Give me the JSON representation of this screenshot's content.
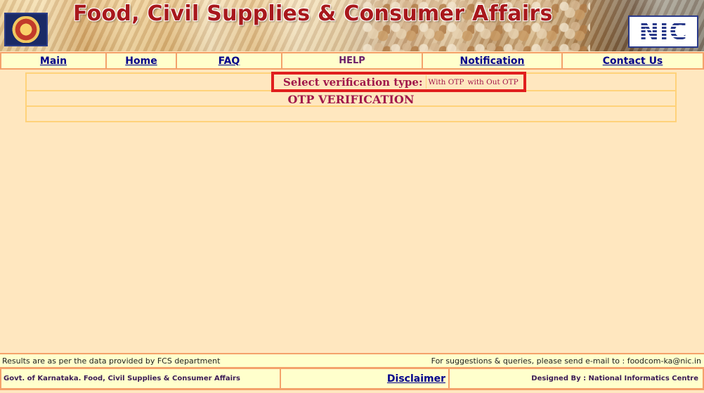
{
  "header": {
    "title": "Food, Civil Supplies & Consumer Affairs",
    "nic_logo_text": "NIC",
    "emblem_icon": "karnataka-emblem-icon"
  },
  "nav": {
    "items": [
      {
        "label": "Main",
        "link": true
      },
      {
        "label": "Home",
        "link": true
      },
      {
        "label": "FAQ",
        "link": true
      },
      {
        "label": "HELP",
        "link": false
      },
      {
        "label": "Notification",
        "link": true
      },
      {
        "label": "Contact Us",
        "link": true
      }
    ]
  },
  "verification": {
    "label": "Select verification type:",
    "options": [
      "With OTP",
      "with Out OTP"
    ]
  },
  "main": {
    "section_title": "OTP VERIFICATION"
  },
  "footer": {
    "data_note": "Results are as per the data provided by FCS department",
    "contact_note": "For suggestions & queries, please send e-mail to : foodcom-ka@nic.in",
    "govt_text": "Govt. of Karnataka. Food, Civil Supplies & Consumer Affairs",
    "disclaimer_label": "Disclaimer",
    "designed_by": "Designed By : National Informatics Centre"
  },
  "colors": {
    "background": "#ffe7bf",
    "nav_bar": "#f4a26b",
    "nav_cell": "#ffffcc",
    "link": "#00008b",
    "title_red": "#a8181c",
    "label_maroon": "#a0174a",
    "highlight_box": "#e01e1e",
    "table_border": "#ffd27a"
  }
}
